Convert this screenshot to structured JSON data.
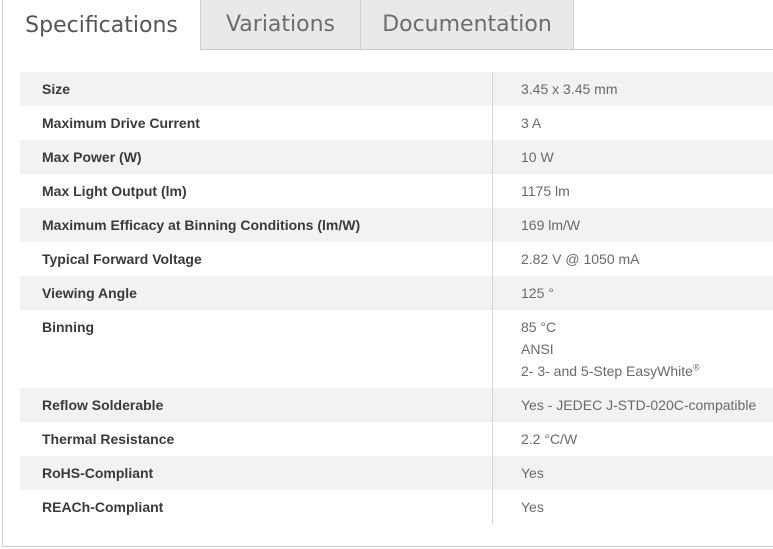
{
  "tabs": [
    {
      "label": "Specifications",
      "active": true
    },
    {
      "label": "Variations",
      "active": false
    },
    {
      "label": "Documentation",
      "active": false
    }
  ],
  "specs": [
    {
      "label": "Size",
      "values": [
        "3.45 x 3.45 mm"
      ]
    },
    {
      "label": "Maximum Drive Current",
      "values": [
        "3 A"
      ]
    },
    {
      "label": "Max Power (W)",
      "values": [
        "10 W"
      ]
    },
    {
      "label": "Max Light Output (lm)",
      "values": [
        "1175 lm"
      ]
    },
    {
      "label": "Maximum Efficacy at Binning Conditions (lm/W)",
      "values": [
        "169 lm/W"
      ]
    },
    {
      "label": "Typical Forward Voltage",
      "values": [
        "2.82 V @ 1050 mA"
      ]
    },
    {
      "label": "Viewing Angle",
      "values": [
        "125 °"
      ]
    },
    {
      "label": "Binning",
      "values": [
        "85 °C",
        "ANSI",
        "2- 3- and 5-Step EasyWhite"
      ],
      "trademark": "®"
    },
    {
      "label": "Reflow Solderable",
      "values": [
        "Yes - JEDEC J-STD-020C-compatible"
      ]
    },
    {
      "label": "Thermal Resistance",
      "values": [
        "2.2 °C/W"
      ]
    },
    {
      "label": "RoHS-Compliant",
      "values": [
        "Yes"
      ]
    },
    {
      "label": "REACh-Compliant",
      "values": [
        "Yes"
      ]
    }
  ]
}
